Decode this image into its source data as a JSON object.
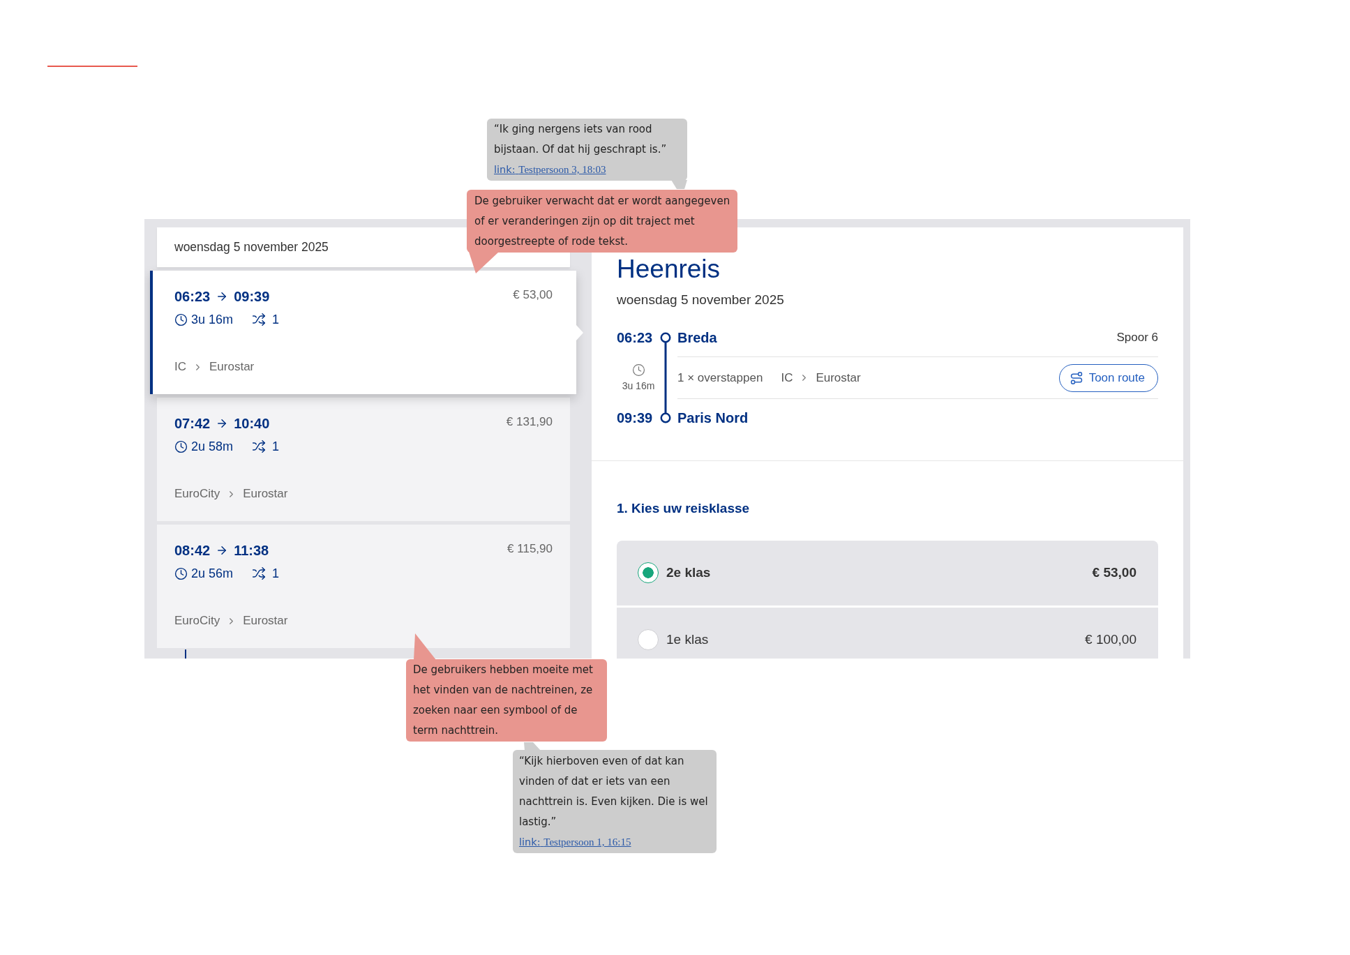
{
  "journey_list": {
    "date_header": "woensdag 5 november 2025",
    "journeys": [
      {
        "departure": "06:23",
        "arrival": "09:39",
        "price": "€ 53,00",
        "duration": "3u 16m",
        "transfers": "1",
        "trains": [
          "IC",
          "Eurostar"
        ],
        "selected": true
      },
      {
        "departure": "07:42",
        "arrival": "10:40",
        "price": "€ 131,90",
        "duration": "2u 58m",
        "transfers": "1",
        "trains": [
          "EuroCity",
          "Eurostar"
        ],
        "selected": false
      },
      {
        "departure": "08:42",
        "arrival": "11:38",
        "price": "€ 115,90",
        "duration": "2u 56m",
        "transfers": "1",
        "trains": [
          "EuroCity",
          "Eurostar"
        ],
        "selected": false
      }
    ]
  },
  "journey_detail": {
    "title": "Heenreis",
    "date": "woensdag 5 november 2025",
    "departure": {
      "time": "06:23",
      "station": "Breda",
      "platform": "Spoor 6"
    },
    "duration": "3u 16m",
    "transfers": "1 × overstappen",
    "trains": [
      "IC",
      "Eurostar"
    ],
    "route_button": "Toon route",
    "arrival": {
      "time": "09:39",
      "station": "Paris Nord"
    }
  },
  "travel_class": {
    "heading": "1. Kies uw reisklasse",
    "options": [
      {
        "label": "2e klas",
        "price": "€ 53,00",
        "selected": true
      },
      {
        "label": "1e klas",
        "price": "€ 100,00",
        "selected": false
      }
    ]
  },
  "annotations": [
    {
      "kind": "quote",
      "text": "“Ik ging nergens iets van rood bijstaan. Of dat hij geschrapt is.”",
      "source": {
        "label": "link:",
        "text": "Testpersoon 3, 18:03"
      }
    },
    {
      "kind": "finding",
      "text": "De gebruiker verwacht dat er wordt aangegeven of er veranderingen zijn op dit traject met doorgestreepte of rode tekst."
    },
    {
      "kind": "finding",
      "text": "De gebruikers hebben moeite met het vinden van de nachtreinen, ze zoeken naar een symbool of de term nachttrein."
    },
    {
      "kind": "quote",
      "text": "“Kijk hierboven even of dat kan vinden of dat er iets van een nachttrein is. Even kijken. Die is wel lastig.”",
      "source": {
        "label": "link:",
        "text": "Testpersoon 1, 16:15"
      }
    }
  ]
}
